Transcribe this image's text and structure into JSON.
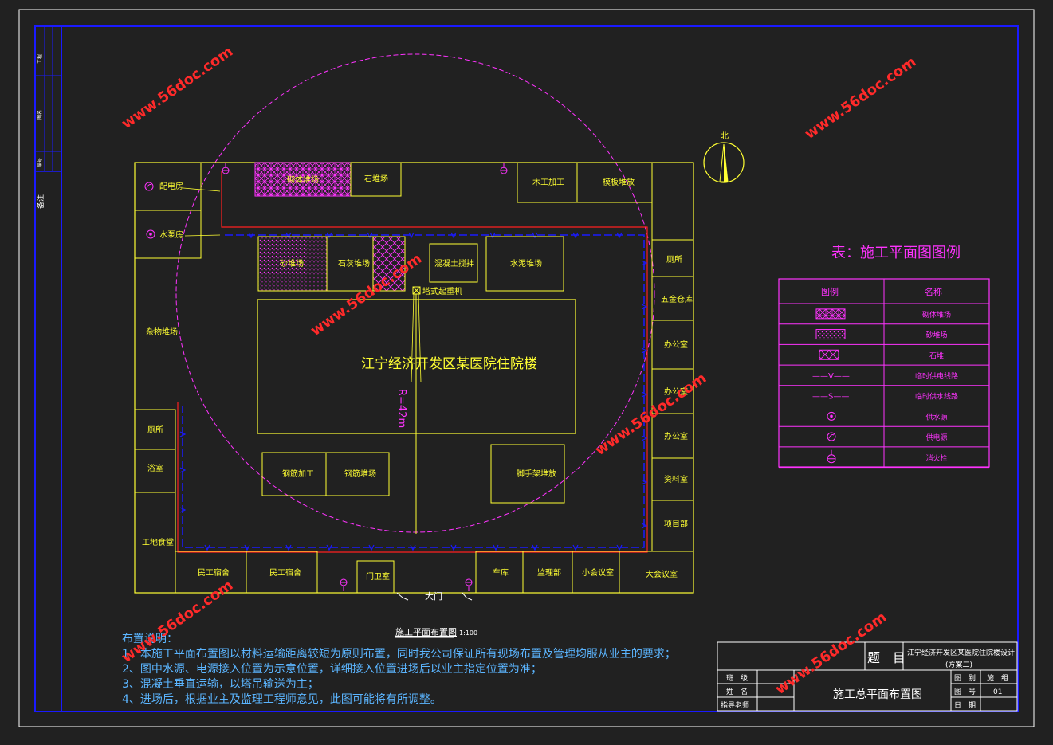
{
  "colors": {
    "frame": "#1a1aff",
    "outer": "#ffffff",
    "building": "#ffff33",
    "magenta": "#ff33ff",
    "pipe": "#ff2020",
    "watermark": "#ff2a2a",
    "notes": "#5bb5ff"
  },
  "watermark": "www.56doc.com",
  "side_strip": {
    "label1": "图名",
    "label2": "工程",
    "label3": "备注",
    "label4": "编号"
  },
  "north": "北",
  "facilities": {
    "power_room": "配电房",
    "pump_room": "水泵房",
    "masonry_yard": "砌体堆场",
    "stone_yard": "石堆场",
    "wood_work": "木工加工",
    "formwork_yard": "模板堆放",
    "sand_yard": "砂堆场",
    "lime_yard": "石灰堆场",
    "concrete_mixer": "混凝土搅拌",
    "cement_yard": "水泥堆场",
    "tower_crane": "塔式起重机",
    "main_building": "江宁经济开发区某医院住院楼",
    "radius": "R=42m",
    "sundry_yard": "杂物堆场",
    "toilet_left": "厕所",
    "bath": "浴室",
    "canteen": "工地食堂",
    "rebar_work": "钢筋加工",
    "rebar_yard": "钢筋堆场",
    "scaffold_yard": "脚手架堆放",
    "toilet_right": "厕所",
    "hardware": "五金仓库",
    "office1": "办公室",
    "office2": "办公室",
    "office3": "办公室",
    "archive": "资料室",
    "project_dept": "项目部",
    "dorm1": "民工宿舍",
    "dorm2": "民工宿舍",
    "guard": "门卫室",
    "gate": "大门",
    "garage": "车库",
    "supervision": "监理部",
    "small_meeting": "小会议室",
    "large_meeting": "大会议室"
  },
  "plan_title": "施工平面布置图",
  "plan_scale": "1:100",
  "legend": {
    "title": "表：施工平面图图例",
    "head_icon": "图例",
    "head_name": "名称",
    "rows": [
      {
        "symbol": "",
        "name": "砌体堆场"
      },
      {
        "symbol": "",
        "name": "砂堆场"
      },
      {
        "symbol": "",
        "name": "石堆"
      },
      {
        "symbol": "——V——",
        "name": "临时供电线路"
      },
      {
        "symbol": "——S——",
        "name": "临时供水线路"
      },
      {
        "symbol": "",
        "name": "供水源"
      },
      {
        "symbol": "",
        "name": "供电源"
      },
      {
        "symbol": "",
        "name": "消火栓"
      }
    ]
  },
  "notes": {
    "title": "布置说明：",
    "lines": [
      "1、本施工平面布置图以材料运输距离较短为原则布置，同时我公司保证所有现场布置及管理均服从业主的要求；",
      "2、图中水源、电源接入位置为示意位置，详细接入位置进场后以业主指定位置为准；",
      "3、混凝土垂直运输，以塔吊输送为主；",
      "4、进场后，根据业主及监理工程师意见，此图可能将有所调整。"
    ]
  },
  "title_block": {
    "topic_label": "题　目",
    "project": "江宁经济开发区某医院住院楼设计",
    "scheme": "(方案二)",
    "class_label": "班　级",
    "name_label": "姓　名",
    "tutor_label": "指导老师",
    "drawing_name": "施工总平面布置图",
    "cat_label": "图　别",
    "cat_value": "施　组",
    "no_label": "图　号",
    "no_value": "01",
    "date_label": "日　期",
    "date_value": ""
  }
}
